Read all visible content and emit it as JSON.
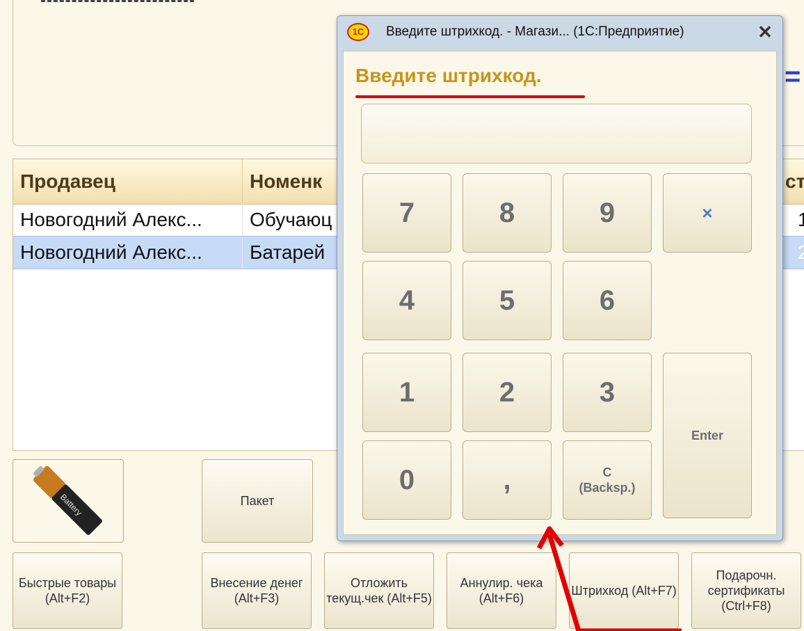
{
  "table": {
    "columns": [
      "Продавец",
      "Номенк",
      "ст"
    ],
    "rows": [
      {
        "seller": "Новогодний Алекс...",
        "item": "Обучаюц",
        "extra": "1"
      },
      {
        "seller": "Новогодний Алекс...",
        "item": "Батарей",
        "extra": "2"
      }
    ]
  },
  "quick_buttons": {
    "battery_label": "Battery",
    "package_label": "Пакет"
  },
  "bottom_buttons": [
    {
      "label": "Быстрые товары (Alt+F2)"
    },
    {
      "label": "Внесение денег (Alt+F3)"
    },
    {
      "label": "Отложить текущ.чек (Alt+F5)"
    },
    {
      "label": "Аннулир. чека (Alt+F6)"
    },
    {
      "label": "Штрихкод (Alt+F7)"
    },
    {
      "label": "Подарочн. сертификаты (Ctrl+F8)"
    }
  ],
  "dialog": {
    "logo": "1С",
    "title": "Введите штрихкод. - Магази... (1С:Предприятие)",
    "close": "✕",
    "heading": "Введите штрихкод.",
    "input_value": "",
    "keys": {
      "k7": "7",
      "k8": "8",
      "k9": "9",
      "clear": "×",
      "k4": "4",
      "k5": "5",
      "k6": "6",
      "k1": "1",
      "k2": "2",
      "k3": "3",
      "enter": "Enter",
      "k0": "0",
      "comma": ",",
      "backspace": "C\n(Backsp.)"
    }
  },
  "colors": {
    "heading": "#c6951a",
    "underline": "#e00000",
    "arrow": "#e00000",
    "selected_row": "#c7daf6"
  }
}
